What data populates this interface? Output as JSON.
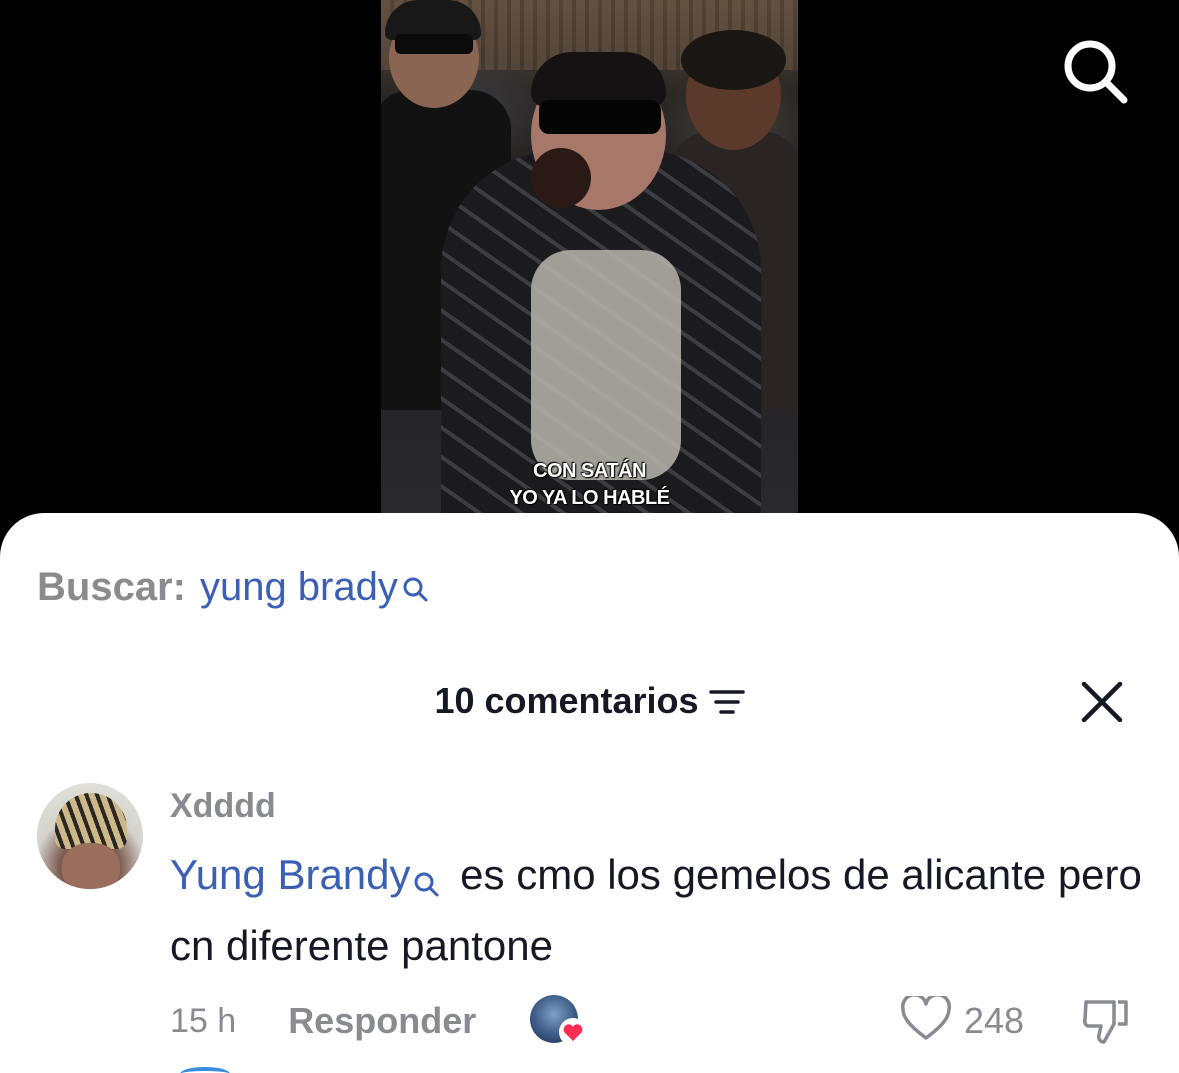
{
  "video": {
    "caption_line1": "CON SATÁN",
    "caption_line2": "YO YA LO HABLÉ"
  },
  "top_bar": {
    "search_icon": "search-icon"
  },
  "search_suggestion": {
    "label": "Buscar:",
    "query": "yung brady",
    "icon": "search-icon"
  },
  "comments": {
    "title": "10 comentarios",
    "sort_icon": "sort-icon",
    "close_icon": "close-icon",
    "items": [
      {
        "username": "Xdddd",
        "mention": "Yung Brandy",
        "text": " es cmo los gemelos de alicante pero cn diferente pantone",
        "time": "15 h",
        "reply_label": "Responder",
        "likes": "248",
        "creator_liked": true
      }
    ]
  },
  "colors": {
    "link": "#3a5fb5",
    "secondary_text": "#8a8b91",
    "primary_text": "#161823",
    "heart_badge": "#fe2c55"
  }
}
